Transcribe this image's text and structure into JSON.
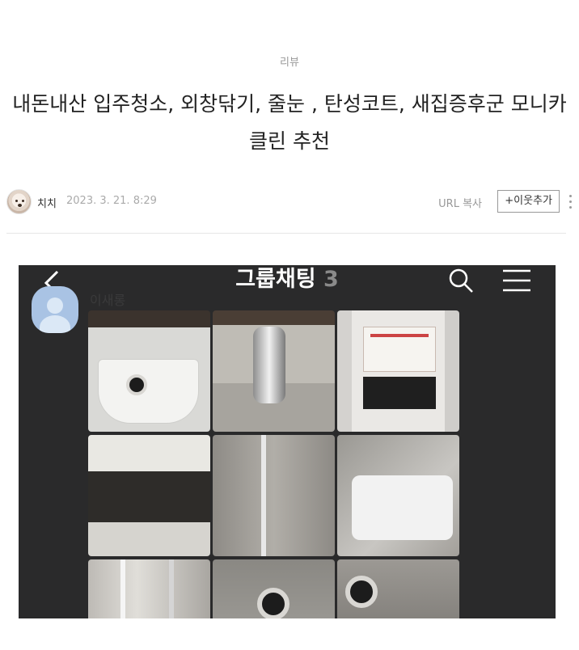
{
  "post": {
    "category": "리뷰",
    "title": "내돈내산 입주청소, 외창닦기, 줄눈 , 탄성코트, 새집증후군 모니카 클린 추천"
  },
  "meta": {
    "author": "치치",
    "date": "2023. 3. 21. 8:29",
    "url_copy": "URL 복사",
    "add_neighbor": "+이웃추가"
  },
  "screenshot": {
    "chat_title": "그룹채팅",
    "member_count": "3",
    "member_name": "이새롱"
  },
  "colors": {
    "title_text": "#222222",
    "muted_text": "#999999",
    "chat_bg": "#2a2a2b",
    "avatar_blue": "#a9c3e4"
  }
}
